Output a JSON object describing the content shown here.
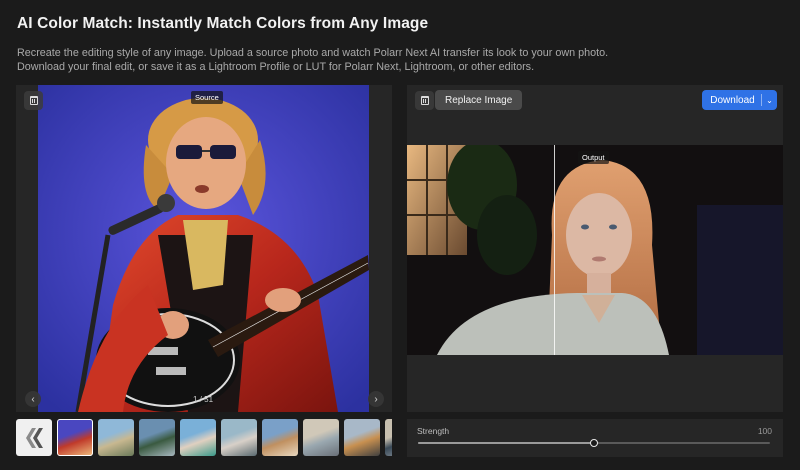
{
  "header": {
    "title": "AI Color Match: Instantly Match Colors from Any Image",
    "description_line1": "Recreate the editing style of any image. Upload a source photo and watch Polarr Next AI transfer its look to your own photo.",
    "description_line2": "Download your final edit, or save it as a Lightroom Profile or LUT for Polarr Next, Lightroom, or other editors."
  },
  "source_panel": {
    "tag": "Source",
    "counter": "1 / 51",
    "prev_glyph": "‹",
    "next_glyph": "›",
    "delete_icon": "trash-icon"
  },
  "output_panel": {
    "tag": "Output",
    "replace_label": "Replace Image",
    "download_label": "Download",
    "download_chevron": "⌄",
    "delete_icon": "trash-icon",
    "split_position": 0.39
  },
  "thumbnails": [
    {
      "kind": "logo",
      "selected": false,
      "colors": [
        "#f0f0f0",
        "#8a8a8a"
      ]
    },
    {
      "kind": "photo",
      "selected": true,
      "colors": [
        "#4a47c0",
        "#c03a2a",
        "#f0c080"
      ]
    },
    {
      "kind": "photo",
      "selected": false,
      "colors": [
        "#8fb8d8",
        "#c8b890",
        "#6a7a5a"
      ]
    },
    {
      "kind": "photo",
      "selected": false,
      "colors": [
        "#6a8fb0",
        "#3a5a40",
        "#a8b8c0"
      ]
    },
    {
      "kind": "photo",
      "selected": false,
      "colors": [
        "#7ab0d8",
        "#e0d0c0",
        "#3a9a8a"
      ]
    },
    {
      "kind": "photo",
      "selected": false,
      "colors": [
        "#9ab8c8",
        "#d8d0c8",
        "#5a6a70"
      ]
    },
    {
      "kind": "photo",
      "selected": false,
      "colors": [
        "#7aa0c8",
        "#c09060",
        "#e8d8c0"
      ]
    },
    {
      "kind": "photo",
      "selected": false,
      "colors": [
        "#d0c8b8",
        "#9aa8b0",
        "#6a7078"
      ]
    },
    {
      "kind": "photo",
      "selected": false,
      "colors": [
        "#a8b8c8",
        "#c89050",
        "#404040"
      ]
    },
    {
      "kind": "photo",
      "selected": false,
      "colors": [
        "#c8c0b0",
        "#3a4a58",
        "#a0a8b0"
      ]
    }
  ],
  "strength": {
    "label": "Strength",
    "value_text": "100",
    "value": 0.5
  },
  "colors": {
    "accent": "#2f72e6",
    "background": "#1b1b1b",
    "panel": "#262626"
  }
}
